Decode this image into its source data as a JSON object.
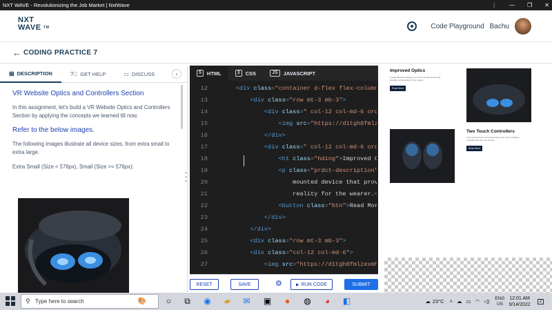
{
  "window": {
    "title": "NXT WAVE - Revolutionizing the Job Market | NxtWave"
  },
  "header": {
    "logo_line1": "NXT",
    "logo_line2": "WAVE",
    "logo_tm": "TM",
    "code_playground": "Code Playground",
    "user_name": "Bachu"
  },
  "subheader": {
    "title": "CODING PRACTICE 7"
  },
  "left_tabs": [
    {
      "label": "DESCRIPTION",
      "icon": "document-icon"
    },
    {
      "label": "GET HELP",
      "icon": "help-icon"
    },
    {
      "label": "DISCUSS",
      "icon": "chat-icon"
    }
  ],
  "description": {
    "heading": "VR Website Optics and Controllers Section",
    "intro": "In this assignment, let's build a VR Website Optics and Controllers Section by applying the concepts we learned till now.",
    "refer": "Refer to the below images.",
    "sizes_text": "The following images illustrate all device sizes, from extra small to extra large.",
    "extra_small": "Extra Small (Size < 576px), Small (Size >= 576px):"
  },
  "editor_tabs": [
    {
      "label": "HTML",
      "icon": "html5-icon"
    },
    {
      "label": "CSS",
      "icon": "css3-icon"
    },
    {
      "label": "JAVASCRIPT",
      "icon": "javascript-icon"
    }
  ],
  "code_lines": [
    {
      "num": "12",
      "indent": "    ",
      "parts": [
        [
          "tg",
          "<div "
        ],
        [
          "at",
          "class"
        ],
        [
          "pn",
          "="
        ],
        [
          "st",
          "\"container d-flex flex-column"
        ]
      ]
    },
    {
      "num": "13",
      "indent": "        ",
      "parts": [
        [
          "tg",
          "<div "
        ],
        [
          "at",
          "class"
        ],
        [
          "pn",
          "="
        ],
        [
          "st",
          "\"row mt-3 mb-3\""
        ],
        [
          "tg",
          ">"
        ]
      ]
    },
    {
      "num": "14",
      "indent": "            ",
      "parts": [
        [
          "tg",
          "<div "
        ],
        [
          "at",
          "class"
        ],
        [
          "pn",
          "="
        ],
        [
          "st",
          "\" col-12 col-md-6 orde"
        ]
      ]
    },
    {
      "num": "15",
      "indent": "                ",
      "parts": [
        [
          "tg",
          "<img "
        ],
        [
          "at",
          "src"
        ],
        [
          "pn",
          "="
        ],
        [
          "st",
          "\"https://d1tgh8fmlze"
        ]
      ]
    },
    {
      "num": "16",
      "indent": "            ",
      "parts": [
        [
          "tg",
          "</div>"
        ]
      ]
    },
    {
      "num": "17",
      "indent": "            ",
      "parts": [
        [
          "tg",
          "<div "
        ],
        [
          "at",
          "class"
        ],
        [
          "pn",
          "="
        ],
        [
          "st",
          "\" col-12 col-md-6 orde"
        ]
      ]
    },
    {
      "num": "18",
      "indent": "                ",
      "parts": [
        [
          "tg",
          "<h1 "
        ],
        [
          "at",
          "class"
        ],
        [
          "pn",
          "="
        ],
        [
          "st",
          "\"hding\""
        ],
        [
          "tg",
          ">"
        ],
        [
          "tx",
          "Improved Op"
        ]
      ]
    },
    {
      "num": "19",
      "indent": "                ",
      "parts": [
        [
          "tg",
          "<p "
        ],
        [
          "at",
          "class"
        ],
        [
          "pn",
          "="
        ],
        [
          "st",
          "\"prdct-description\""
        ],
        [
          "tg",
          ">"
        ]
      ]
    },
    {
      "num": "20",
      "indent": "                    ",
      "parts": [
        [
          "tx",
          "mounted device that provi"
        ]
      ]
    },
    {
      "num": "21",
      "indent": "                    ",
      "parts": [
        [
          "tx",
          "reality for the wearer."
        ],
        [
          "tg",
          "</"
        ]
      ]
    },
    {
      "num": "22",
      "indent": "                ",
      "parts": [
        [
          "tg",
          "<button "
        ],
        [
          "at",
          "class"
        ],
        [
          "pn",
          "="
        ],
        [
          "st",
          "\"btn\""
        ],
        [
          "tg",
          ">"
        ],
        [
          "tx",
          "Read More"
        ]
      ]
    },
    {
      "num": "23",
      "indent": "            ",
      "parts": [
        [
          "tg",
          "</div>"
        ]
      ]
    },
    {
      "num": "24",
      "indent": "        ",
      "parts": [
        [
          "tg",
          "</div>"
        ]
      ]
    },
    {
      "num": "25",
      "indent": "        ",
      "parts": [
        [
          "tg",
          "<div "
        ],
        [
          "at",
          "class"
        ],
        [
          "pn",
          "="
        ],
        [
          "st",
          "\"row mt-3 mb-3\""
        ],
        [
          "tg",
          ">"
        ]
      ]
    },
    {
      "num": "26",
      "indent": "        ",
      "parts": [
        [
          "tg",
          "<div "
        ],
        [
          "at",
          "class"
        ],
        [
          "pn",
          "="
        ],
        [
          "st",
          "\"col-12 col-md-6\""
        ],
        [
          "tg",
          ">"
        ]
      ]
    },
    {
      "num": "27",
      "indent": "            ",
      "parts": [
        [
          "tg",
          "<img "
        ],
        [
          "at",
          "src"
        ],
        [
          "pn",
          "="
        ],
        [
          "st",
          "\"https://d1tgh8fmlzexmh."
        ]
      ]
    }
  ],
  "actions": {
    "reset": "RESET",
    "save": "SAVE",
    "run_code": "RUN CODE",
    "submit": "SUBMIT"
  },
  "preview": {
    "improved_title": "Improved Optics",
    "improved_desc": "A Head Mounted display is a head mounted device that provides virtual reality for the wearer",
    "read_more_1": "Read More",
    "controllers_title": "Two Touch Controllers",
    "controllers_desc": "Your Oculus Touch Controllers track every part of tracked controller that give you a hand",
    "read_more_2": "Read More"
  },
  "taskbar": {
    "search_placeholder": "Type here to search",
    "temperature": "23°C",
    "lang_line1": "ENG",
    "lang_line2": "US",
    "time": "12:01 AM",
    "date": "9/14/2022",
    "notification_count": "2"
  },
  "colors": {
    "brand": "#183b56",
    "accent": "#1e6fe8",
    "editor_bg": "#1e1e1e"
  }
}
